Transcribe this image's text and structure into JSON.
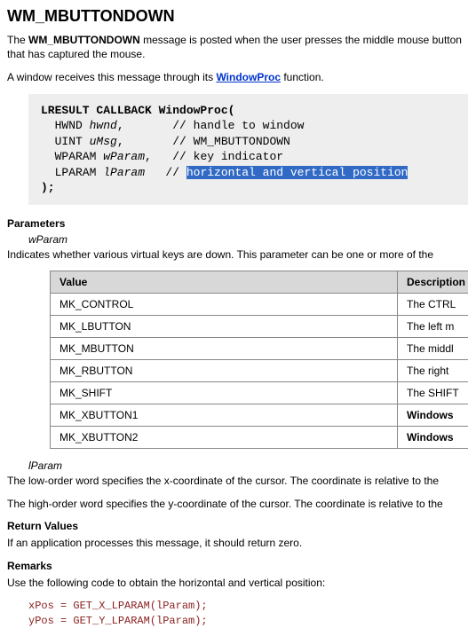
{
  "title": "WM_MBUTTONDOWN",
  "intro1_a": "The ",
  "intro1_b": "WM_MBUTTONDOWN",
  "intro1_c": " message is posted when the user presses the middle mouse button that has captured the mouse.",
  "intro2_a": "A window receives this message through its ",
  "intro2_link": "WindowProc",
  "intro2_b": " function.",
  "code": {
    "l1a": "LRESULT CALLBACK WindowProc(",
    "l2a": "  HWND ",
    "l2b": "hwnd",
    "l2c": ",       // handle to window",
    "l3a": "  UINT ",
    "l3b": "uMsg",
    "l3c": ",       // WM_MBUTTONDOWN",
    "l4a": "  WPARAM ",
    "l4b": "wParam",
    "l4c": ",   // key indicator",
    "l5a": "  LPARAM ",
    "l5b": "lParam",
    "l5c": "   // ",
    "l5hl": "horizontal and vertical position",
    "l6": ");"
  },
  "sections": {
    "parameters": "Parameters",
    "return_values": "Return Values",
    "remarks": "Remarks"
  },
  "param1": {
    "name": "wParam",
    "desc": "Indicates whether various virtual keys are down. This parameter can be one or more of the"
  },
  "table_headers": {
    "value": "Value",
    "desc": "Description"
  },
  "rows": [
    {
      "v": "MK_CONTROL",
      "d": "The CTRL",
      "bold": false
    },
    {
      "v": "MK_LBUTTON",
      "d": "The left m",
      "bold": false
    },
    {
      "v": "MK_MBUTTON",
      "d": "The middl",
      "bold": false
    },
    {
      "v": "MK_RBUTTON",
      "d": "The right",
      "bold": false
    },
    {
      "v": "MK_SHIFT",
      "d": "The SHIFT",
      "bold": false
    },
    {
      "v": "MK_XBUTTON1",
      "d": "Windows",
      "bold": true
    },
    {
      "v": "MK_XBUTTON2",
      "d": "Windows",
      "bold": true
    }
  ],
  "param2": {
    "name": "lParam",
    "desc1": "The low-order word specifies the x-coordinate of the cursor. The coordinate is relative to the",
    "desc2": "The high-order word specifies the y-coordinate of the cursor. The coordinate is relative to the"
  },
  "return_text": "If an application processes this message, it should return zero.",
  "remarks_text": "Use the following code to obtain the horizontal and vertical position:",
  "remarks_code": "xPos = GET_X_LPARAM(lParam);\nyPos = GET_Y_LPARAM(lParam);"
}
